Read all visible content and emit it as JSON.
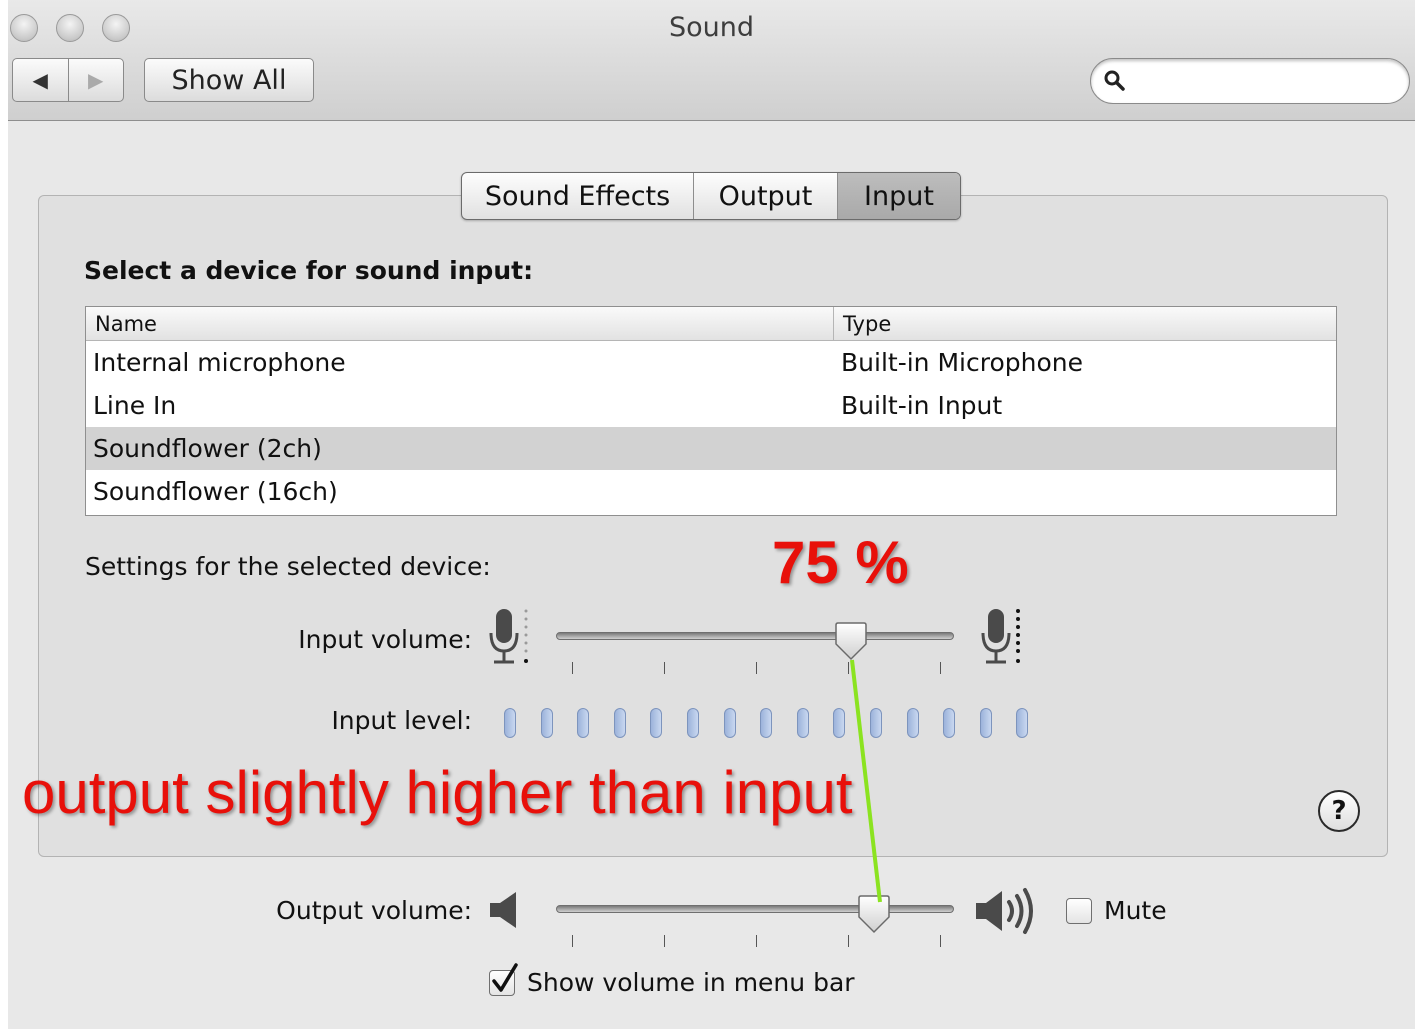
{
  "window": {
    "title": "Sound"
  },
  "toolbar": {
    "show_all_label": "Show All",
    "back_glyph": "◀",
    "forward_glyph": "▶",
    "search": {
      "value": "",
      "placeholder": ""
    }
  },
  "tabs": [
    {
      "label": "Sound Effects",
      "active": false
    },
    {
      "label": "Output",
      "active": false
    },
    {
      "label": "Input",
      "active": true
    }
  ],
  "input": {
    "section_title": "Select a device for sound input:",
    "columns": [
      "Name",
      "Type"
    ],
    "devices": [
      {
        "name": "Internal microphone",
        "type": "Built-in Microphone",
        "selected": false
      },
      {
        "name": "Line In",
        "type": "Built-in Input",
        "selected": false
      },
      {
        "name": "Soundflower (2ch)",
        "type": "",
        "selected": true
      },
      {
        "name": "Soundflower (16ch)",
        "type": "",
        "selected": false
      }
    ],
    "settings_label": "Settings for the selected device:",
    "input_volume_label": "Input volume:",
    "input_volume_fraction": 0.74,
    "input_level_label": "Input level:",
    "input_level_bars": 15,
    "input_level_active": 0
  },
  "output": {
    "output_volume_label": "Output volume:",
    "output_volume_fraction": 0.8,
    "mute_label": "Mute",
    "mute_checked": false,
    "show_volume_label": "Show volume in menu bar",
    "show_volume_checked": true
  },
  "help": {
    "label": "?"
  },
  "annotations": {
    "percent_text": "75 %",
    "note_text": "output slightly higher than input",
    "text_color": "#e8100a",
    "line_color": "#8be320"
  }
}
